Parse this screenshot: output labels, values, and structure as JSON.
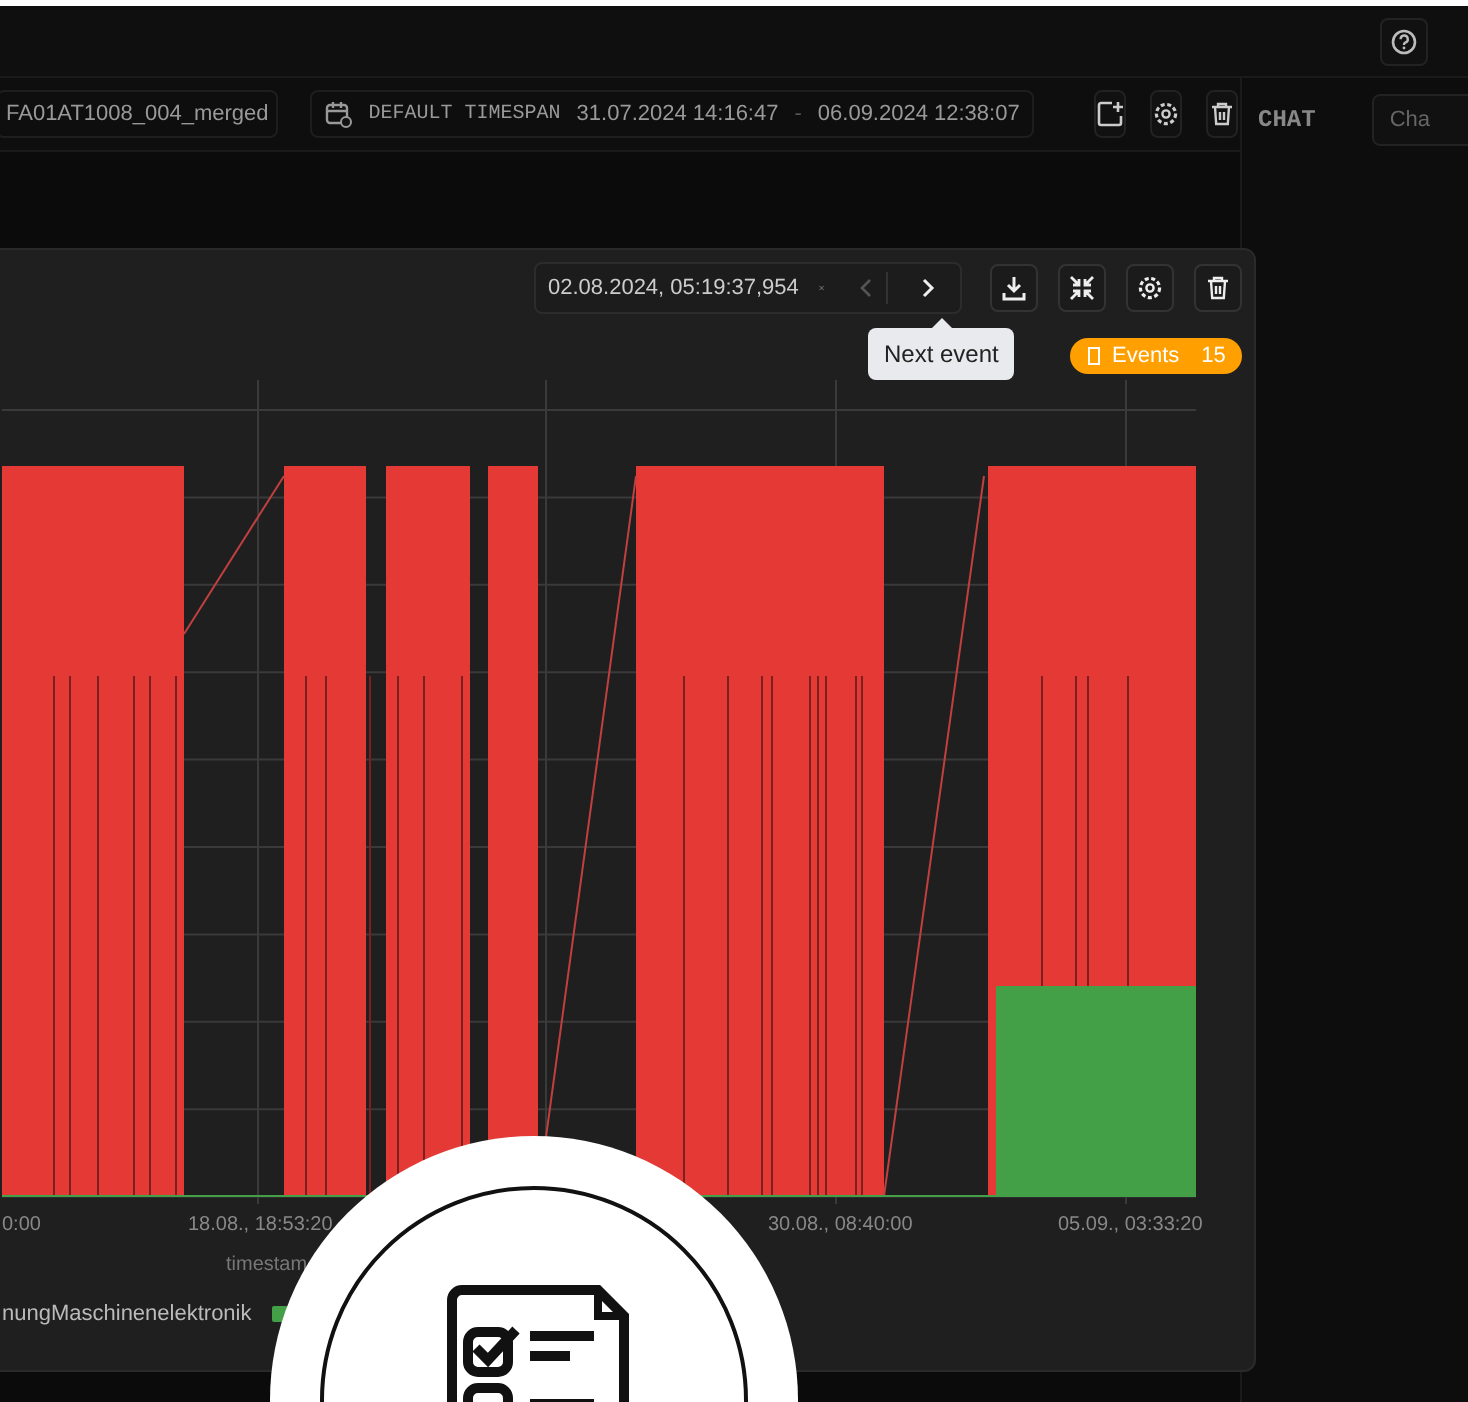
{
  "toolbar": {
    "dataset": "FA01AT1008_004_merged",
    "timespan_label": "DEFAULT TIMESPAN",
    "start": "31.07.2024 14:16:47",
    "separator": "-",
    "end": "06.09.2024 12:38:07"
  },
  "chat": {
    "title": "CHAT",
    "placeholder": "Cha"
  },
  "panel": {
    "event_time": "02.08.2024, 05:19:37,954",
    "prev_disabled": true,
    "tooltip": "Next event",
    "events_label": "Events",
    "events_count": "15",
    "x_labels": [
      "0:00",
      "18.08., 18:53:20",
      "30.08., 08:40:00",
      "05.09., 03:33:20"
    ],
    "x_title": "timestam",
    "legend": [
      "nungMaschinenelektronik"
    ]
  }
}
